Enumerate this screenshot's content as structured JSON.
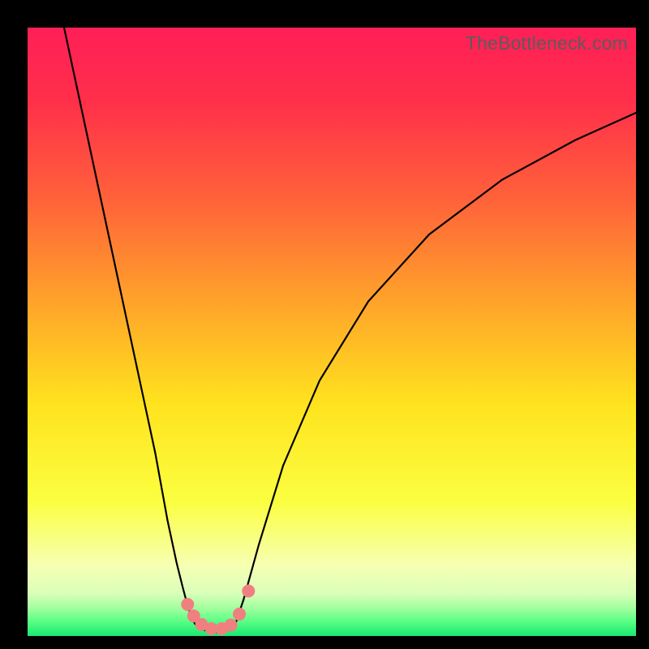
{
  "watermark": "TheBottleneck.com",
  "chart_data": {
    "type": "line",
    "title": "",
    "xlabel": "",
    "ylabel": "",
    "xlim": [
      0,
      100
    ],
    "ylim": [
      0,
      100
    ],
    "gradient_stops": [
      {
        "offset": 0.0,
        "color": "#ff1f57"
      },
      {
        "offset": 0.12,
        "color": "#ff2f4a"
      },
      {
        "offset": 0.28,
        "color": "#ff613a"
      },
      {
        "offset": 0.45,
        "color": "#ffa32a"
      },
      {
        "offset": 0.62,
        "color": "#ffe31e"
      },
      {
        "offset": 0.78,
        "color": "#fbff41"
      },
      {
        "offset": 0.885,
        "color": "#f6ffb3"
      },
      {
        "offset": 0.93,
        "color": "#d9ffb9"
      },
      {
        "offset": 0.955,
        "color": "#a0ff9d"
      },
      {
        "offset": 0.975,
        "color": "#5cff86"
      },
      {
        "offset": 1.0,
        "color": "#19e86f"
      }
    ],
    "series": [
      {
        "name": "left-branch",
        "x": [
          6,
          9,
          12,
          15,
          18,
          21,
          23,
          24.5,
          25.5,
          26.3,
          27,
          27.5,
          28
        ],
        "y": [
          100,
          86,
          72,
          58,
          44,
          30,
          19,
          12,
          8,
          5,
          3,
          2,
          1.5
        ]
      },
      {
        "name": "valley-floor",
        "x": [
          28,
          29,
          30,
          31,
          32,
          33,
          34
        ],
        "y": [
          1.5,
          1,
          0.7,
          0.6,
          0.7,
          1,
          1.5
        ]
      },
      {
        "name": "right-branch",
        "x": [
          34,
          35.5,
          38,
          42,
          48,
          56,
          66,
          78,
          90,
          100
        ],
        "y": [
          1.5,
          6,
          15,
          28,
          42,
          55,
          66,
          75,
          81.5,
          86
        ]
      }
    ],
    "markers": {
      "name": "valley-markers",
      "color": "#f08080",
      "radius_px": 8,
      "points": [
        {
          "x": 26.3,
          "y": 5.2
        },
        {
          "x": 27.3,
          "y": 3.3
        },
        {
          "x": 28.6,
          "y": 1.9
        },
        {
          "x": 30.2,
          "y": 1.2
        },
        {
          "x": 31.9,
          "y": 1.2
        },
        {
          "x": 33.4,
          "y": 1.8
        },
        {
          "x": 34.8,
          "y": 3.6
        },
        {
          "x": 36.3,
          "y": 7.4
        }
      ]
    }
  }
}
